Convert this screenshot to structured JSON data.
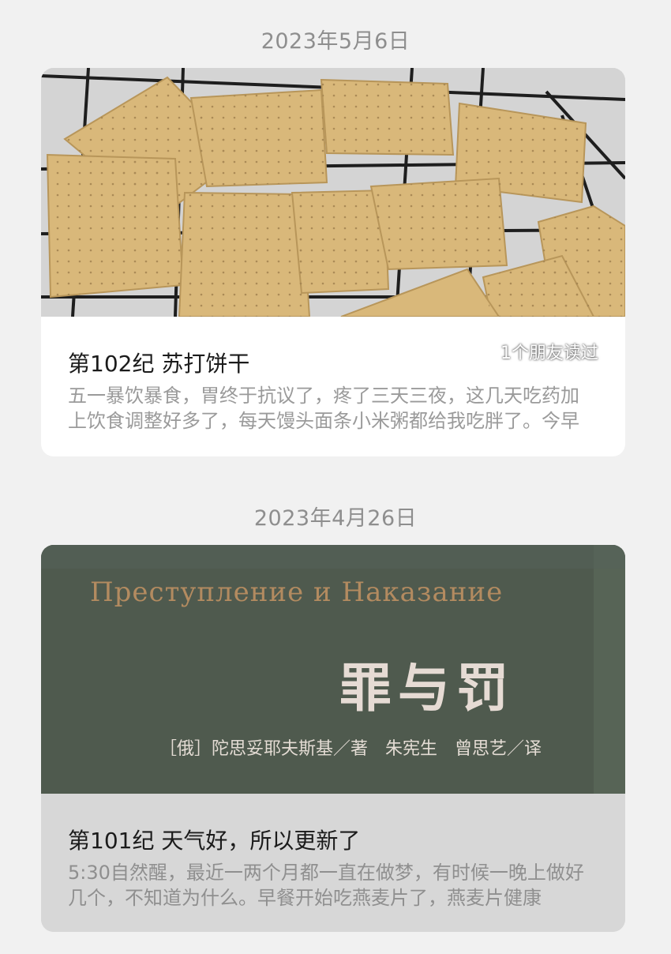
{
  "posts": [
    {
      "date": "2023年5月6日",
      "title": "第102纪 苏打饼干",
      "reads": "1个朋友读过",
      "excerpt": "五一暴饮暴食，胃终于抗议了，疼了三天三夜，这几天吃药加上饮食调整好多了，每天馒头面条小米粥都给我吃胖了。今早",
      "cover": "crackers-photo"
    },
    {
      "date": "2023年4月26日",
      "title": "第101纪 天气好，所以更新了",
      "excerpt": "5:30自然醒，最近一两个月都一直在做梦，有时候一晚上做好几个，不知道为什么。早餐开始吃燕麦片了，燕麦片健康",
      "cover": "book-cover-photo",
      "book": {
        "title_ru": "Преступление и Наказание",
        "title_cn": "罪与罚",
        "authors": "［俄］陀思妥耶夫斯基／著　朱宪生　曾思艺／译"
      }
    }
  ],
  "colors": {
    "background": "#f1f1f1",
    "cracker": "#d9b87a",
    "book_cover": "#4f5a4e"
  }
}
